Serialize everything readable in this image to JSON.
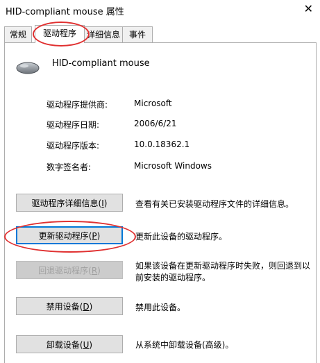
{
  "window": {
    "title": "HID-compliant mouse 属性",
    "close_glyph": "✕"
  },
  "tabs": [
    {
      "label": "常规"
    },
    {
      "label": "驱动程序",
      "active": true
    },
    {
      "label": "详细信息"
    },
    {
      "label": "事件"
    }
  ],
  "device": {
    "name": "HID-compliant mouse",
    "icon": "mouse-icon"
  },
  "info": [
    {
      "label": "驱动程序提供商:",
      "value": "Microsoft"
    },
    {
      "label": "驱动程序日期:",
      "value": "2006/6/21"
    },
    {
      "label": "驱动程序版本:",
      "value": "10.0.18362.1"
    },
    {
      "label": "数字签名者:",
      "value": "Microsoft Windows"
    }
  ],
  "actions": [
    {
      "label": "驱动程序详细信息",
      "mnemonic": "I",
      "description": "查看有关已安装驱动程序文件的详细信息。"
    },
    {
      "label": "更新驱动程序",
      "mnemonic": "P",
      "description": "更新此设备的驱动程序。",
      "focused": true
    },
    {
      "label": "回退驱动程序",
      "mnemonic": "R",
      "description": "如果该设备在更新驱动程序时失败，则回退到以前安装的驱动程序。",
      "disabled": true
    },
    {
      "label": "禁用设备",
      "mnemonic": "D",
      "description": "禁用此设备。"
    },
    {
      "label": "卸载设备",
      "mnemonic": "U",
      "description": "从系统中卸载设备(高级)。"
    }
  ],
  "annotation_color": "#e03030"
}
